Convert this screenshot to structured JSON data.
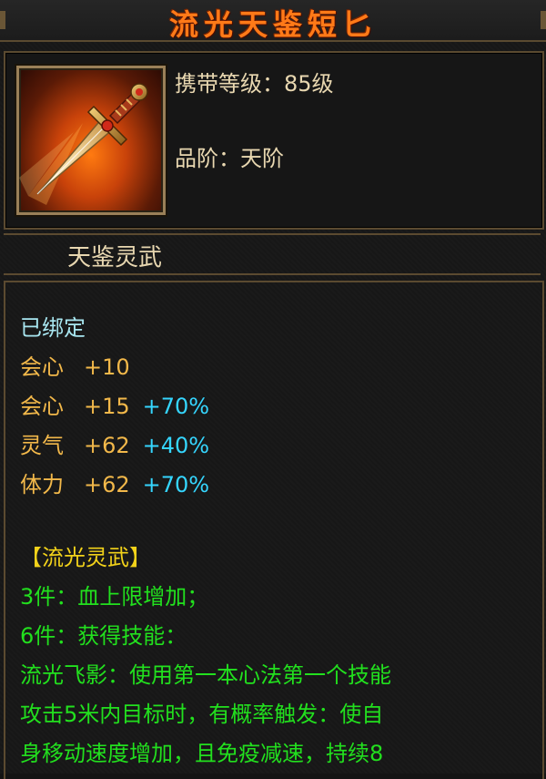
{
  "item": {
    "name": "流光天鉴短匕",
    "level_label": "携带等级：",
    "level_value": "85级",
    "grade_label": "品阶：",
    "grade_value": "天阶",
    "set_name": "天鉴灵武",
    "icon": "golden-dagger-icon"
  },
  "stats": {
    "bound": "已绑定",
    "base": [
      {
        "name": "会心",
        "value": "+10",
        "pct": ""
      },
      {
        "name": "会心",
        "value": "+15",
        "pct": "+70%"
      },
      {
        "name": "灵气",
        "value": "+62",
        "pct": "+40%"
      },
      {
        "name": "体力",
        "value": "+62",
        "pct": "+70%"
      }
    ],
    "set_title": "【流光灵武】",
    "set_effects": [
      "3件：血上限增加；",
      "6件：获得技能：",
      "流光飞影：使用第一本心法第一个技能",
      "攻击5米内目标时，有概率触发：使自",
      "身移动速度增加，且免疫减速，持续8"
    ]
  },
  "colors": {
    "title": "#ff7a18",
    "label": "#e8d7b0",
    "stat": "#f2b84a",
    "percent": "#35d6ff",
    "set_effect": "#22e01e",
    "set_title": "#f2d21a",
    "bound": "#a8e6f0",
    "border": "#5b4a30"
  }
}
